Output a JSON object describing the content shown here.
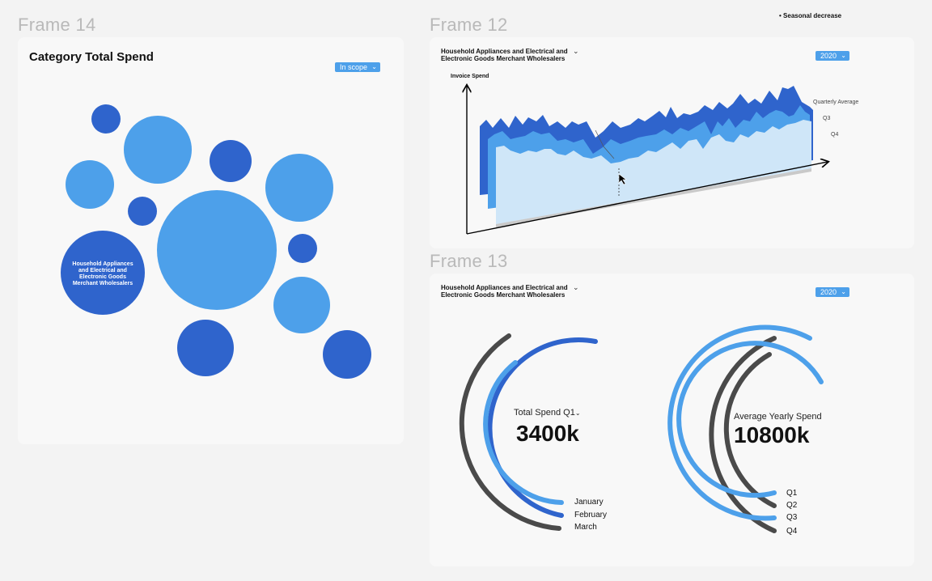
{
  "frames": {
    "frame14": "Frame 14",
    "frame12": "Frame 12",
    "frame13": "Frame 13"
  },
  "tooltip": {
    "text": "Seasonal decrease"
  },
  "bubble": {
    "title": "Category Total Spend",
    "filter": "In scope",
    "highlight_label": "Household Appliances and Electrical and Electronic Goods Merchant Wholesalers",
    "colors": {
      "dark": "#2f64cc",
      "light": "#4da0ea"
    }
  },
  "area": {
    "header": "Household Appliances and Electrical and Electronic Goods Merchant Wholesalers",
    "year": "2020",
    "y_label": "Invoice Spend",
    "legend": [
      "Quarterly Average",
      "Q3",
      "Q4"
    ],
    "colors": {
      "back": "#2f64cc",
      "mid": "#4da0ea",
      "front": "#cfe6f8"
    }
  },
  "radial": {
    "header": "Household Appliances and Electrical and Electronic Goods Merchant Wholesalers",
    "year": "2020",
    "left": {
      "label": "Total Spend Q1",
      "value": "3400k",
      "legend": [
        "January",
        "February",
        "March"
      ]
    },
    "right": {
      "label": "Average Yearly Spend",
      "value": "10800k",
      "legend": [
        "Q1",
        "Q2",
        "Q3",
        "Q4"
      ]
    },
    "colors": {
      "dark": "#2f64cc",
      "light": "#4da0ea",
      "gray": "#4a4a4a"
    }
  }
}
